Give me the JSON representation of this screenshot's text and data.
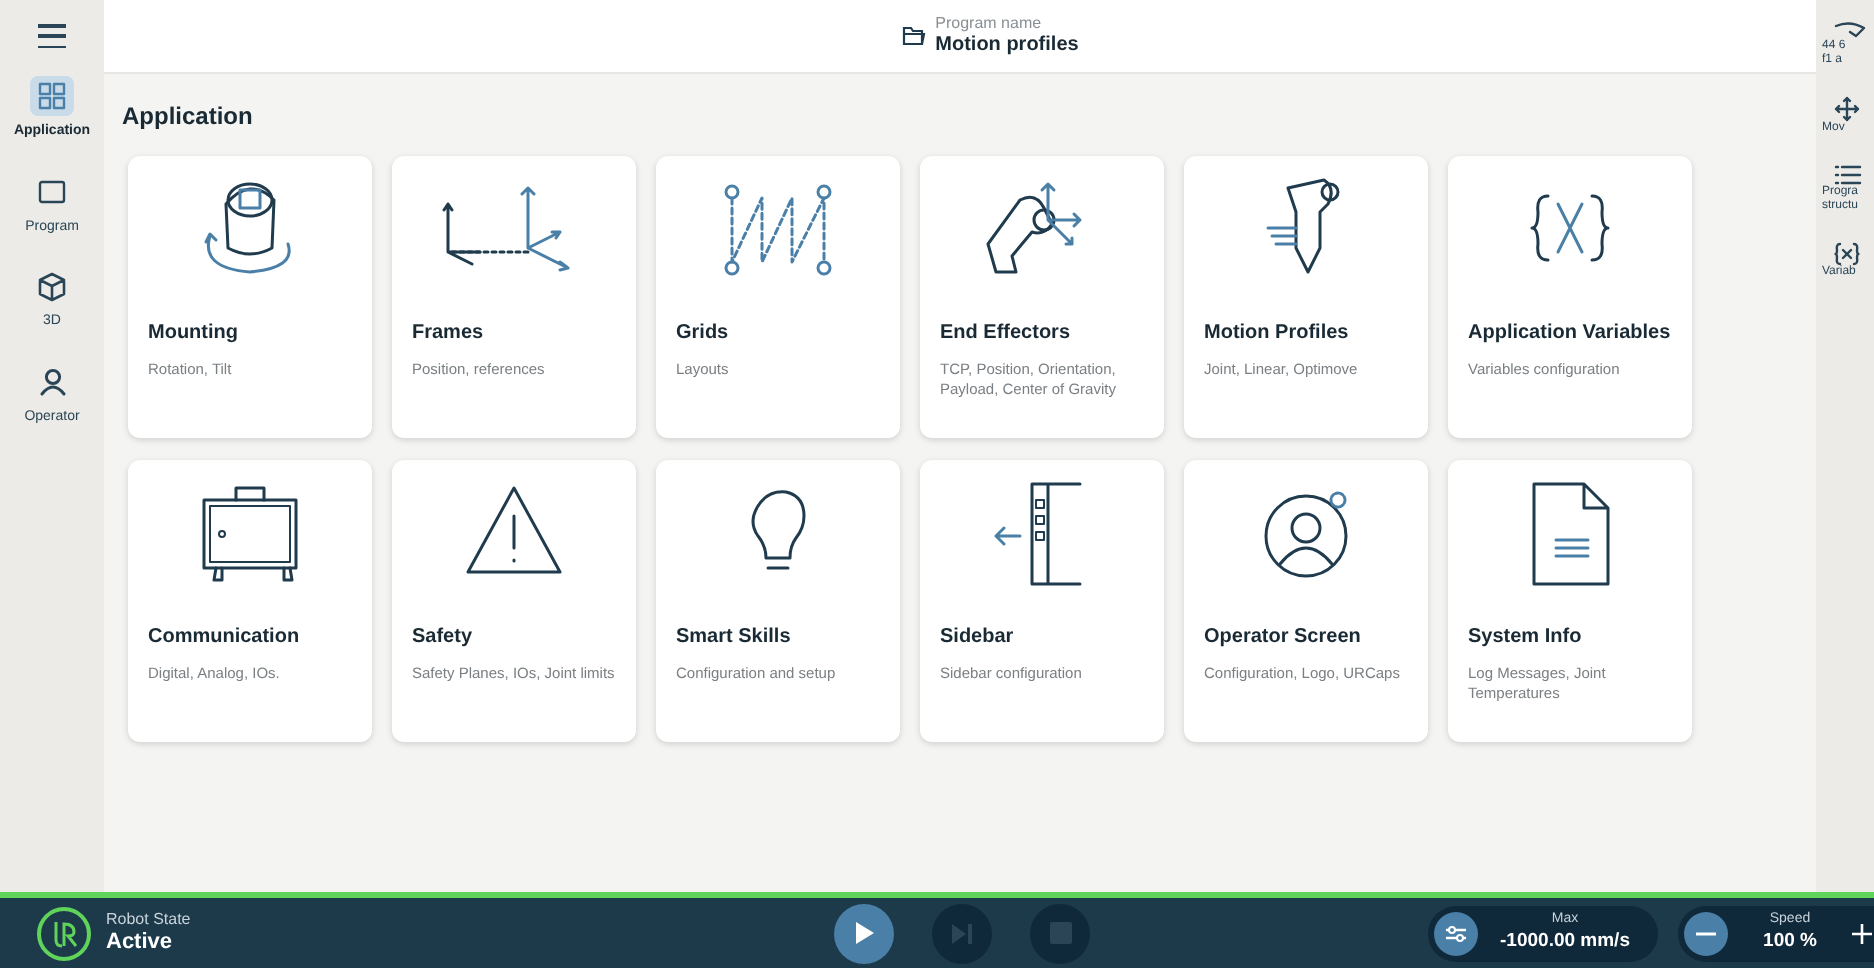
{
  "header": {
    "label": "Program name",
    "program": "Motion profiles"
  },
  "sidebar": {
    "items": [
      {
        "label": "Application",
        "selected": true
      },
      {
        "label": "Program",
        "selected": false
      },
      {
        "label": "3D",
        "selected": false
      },
      {
        "label": "Operator",
        "selected": false
      }
    ]
  },
  "right_panel": {
    "items": [
      {
        "lines": [
          "44 6",
          "f1 a"
        ]
      },
      {
        "lines": [
          "Mov"
        ]
      },
      {
        "lines": [
          "Progra",
          "structu"
        ]
      },
      {
        "lines": [
          "Variab"
        ]
      }
    ]
  },
  "page_title": "Application",
  "cards": [
    {
      "title": "Mounting",
      "subtitle": "Rotation, Tilt"
    },
    {
      "title": "Frames",
      "subtitle": "Position, references"
    },
    {
      "title": "Grids",
      "subtitle": "Layouts"
    },
    {
      "title": "End Effectors",
      "subtitle": "TCP, Position, Orientation, Payload, Center of Gravity"
    },
    {
      "title": "Motion Profiles",
      "subtitle": "Joint, Linear, Optimove"
    },
    {
      "title": "Application Variables",
      "subtitle": "Variables configuration"
    },
    {
      "title": "Communication",
      "subtitle": "Digital, Analog, IOs."
    },
    {
      "title": "Safety",
      "subtitle": "Safety Planes, IOs, Joint limits"
    },
    {
      "title": "Smart Skills",
      "subtitle": "Configuration and setup"
    },
    {
      "title": "Sidebar",
      "subtitle": "Sidebar configuration"
    },
    {
      "title": "Operator Screen",
      "subtitle": "Configuration, Logo, URCaps"
    },
    {
      "title": "System Info",
      "subtitle": "Log Messages, Joint Temperatures"
    }
  ],
  "status_bar": {
    "robot_state_label": "Robot State",
    "robot_state": "Active",
    "controls": [
      {
        "kind": "play",
        "disabled": false
      },
      {
        "kind": "step",
        "disabled": true
      },
      {
        "kind": "stop",
        "disabled": true
      }
    ],
    "max": {
      "label": "Max",
      "value": "-1000.00 mm/s"
    },
    "speed": {
      "label": "Speed",
      "value": "100 %"
    }
  }
}
